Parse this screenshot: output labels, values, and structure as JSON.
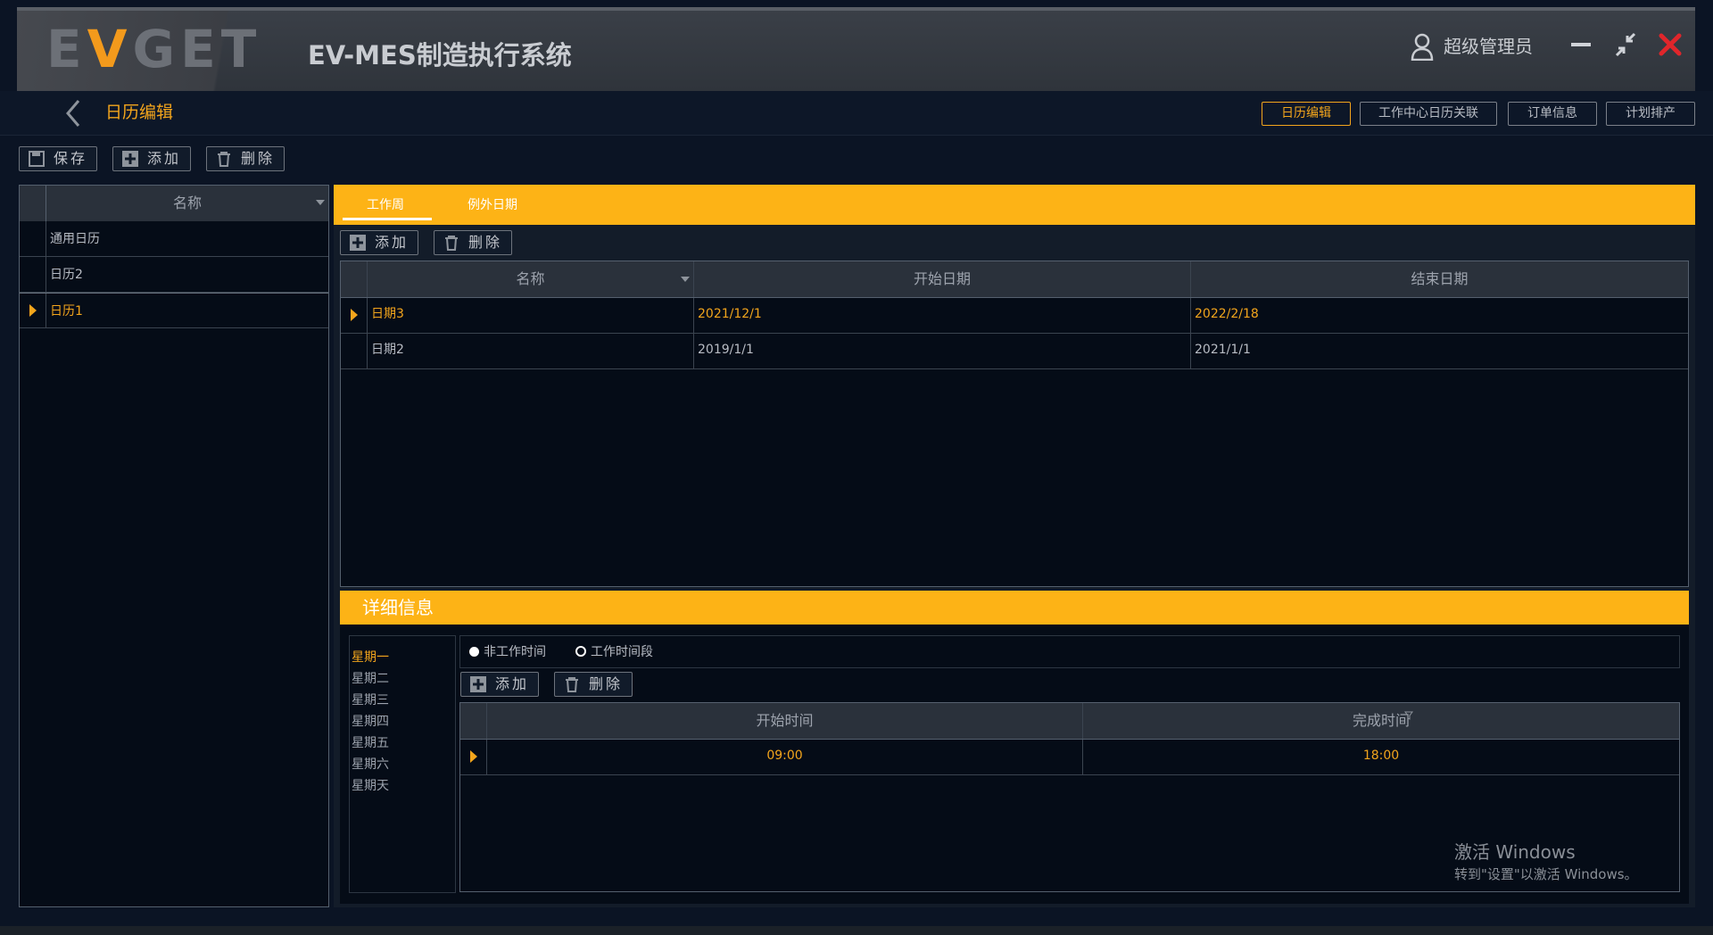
{
  "header": {
    "logo": "EVGET",
    "app_title": "EV-MES制造执行系统",
    "user_name": "超级管理员"
  },
  "subheader": {
    "page_title": "日历编辑",
    "nav_buttons": [
      "日历编辑",
      "工作中心日历关联",
      "订单信息",
      "计划排产"
    ]
  },
  "toolbar": {
    "save": "保存",
    "add": "添加",
    "delete": "删除"
  },
  "calendar_list": {
    "column": "名称",
    "rows": [
      "通用日历",
      "日历2",
      "日历1"
    ],
    "selected": "日历1"
  },
  "tabs": [
    "工作周",
    "例外日期"
  ],
  "work_week": {
    "add": "添加",
    "delete": "删除",
    "columns": [
      "名称",
      "开始日期",
      "结束日期"
    ],
    "rows": [
      {
        "name": "日期3",
        "start": "2021/12/1",
        "end": "2022/2/18"
      },
      {
        "name": "日期2",
        "start": "2019/1/1",
        "end": "2021/1/1"
      }
    ]
  },
  "detail": {
    "title": "详细信息",
    "days": [
      "星期一",
      "星期二",
      "星期三",
      "星期四",
      "星期五",
      "星期六",
      "星期天"
    ],
    "radio_options": [
      "非工作时间",
      "工作时间段"
    ],
    "add": "添加",
    "delete": "删除",
    "columns": [
      "开始时间",
      "完成时间"
    ],
    "rows": [
      {
        "start": "09:00",
        "end": "18:00"
      }
    ]
  },
  "watermark": {
    "line1": "激活 Windows",
    "line2": "转到\"设置\"以激活 Windows。"
  },
  "colors": {
    "accent": "#fdb316",
    "background": "#0b1424",
    "close": "#e0262b"
  }
}
